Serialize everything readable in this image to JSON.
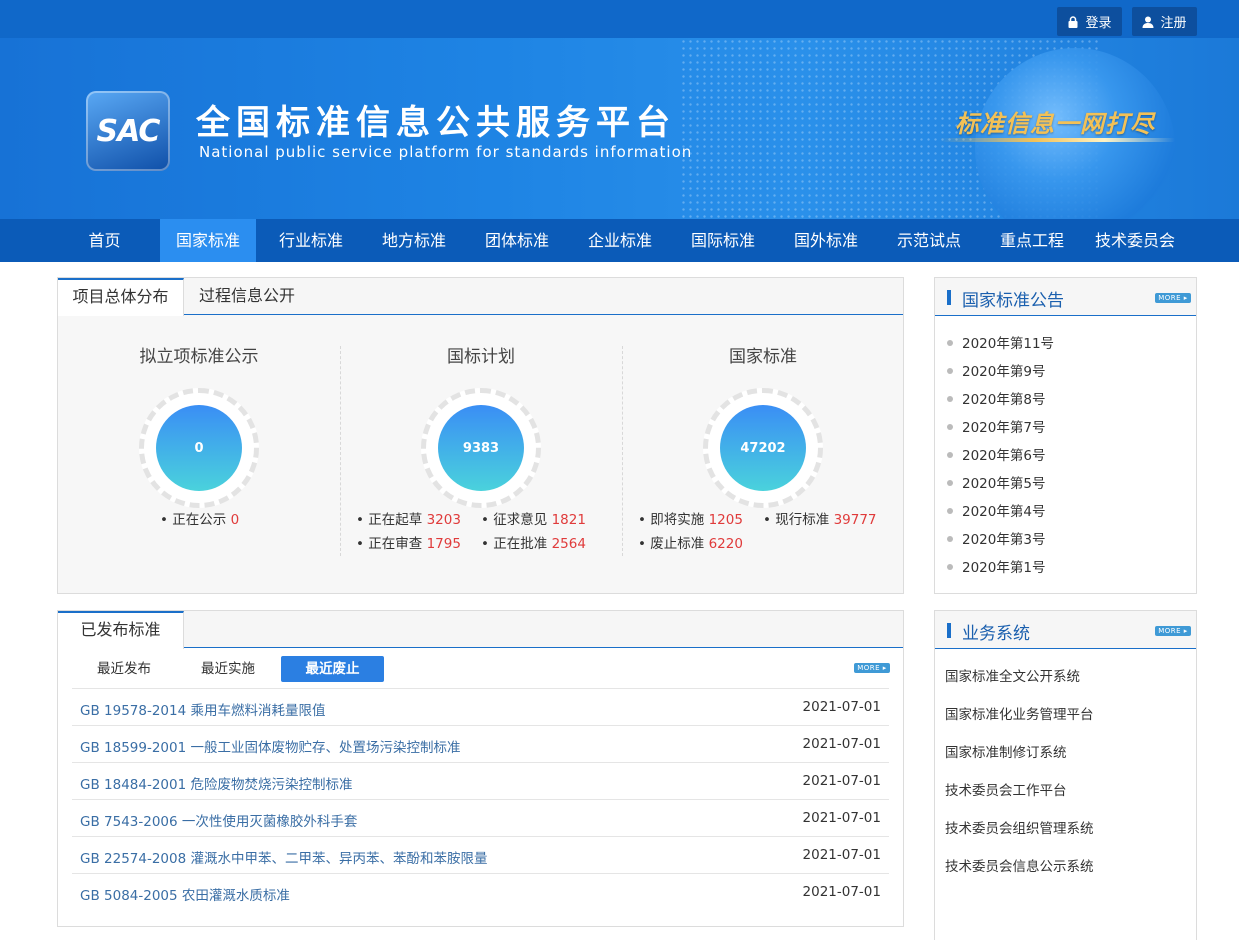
{
  "topbar": {
    "login": "登录",
    "register": "注册"
  },
  "banner": {
    "logo_text": "SAC",
    "title_cn": "全国标准信息公共服务平台",
    "title_en": "National public service platform  for standards information",
    "slogan": "标准信息一网打尽"
  },
  "nav": {
    "items": [
      "首页",
      "国家标准",
      "行业标准",
      "地方标准",
      "团体标准",
      "企业标准",
      "国际标准",
      "国外标准",
      "示范试点",
      "重点工程",
      "技术委员会"
    ],
    "active_index": 1
  },
  "overview": {
    "tabs": [
      "项目总体分布",
      "过程信息公开"
    ],
    "columns": [
      {
        "title": "拟立项标准公示",
        "total": "0",
        "lines": [
          [
            {
              "label": "正在公示",
              "value": "0"
            }
          ]
        ]
      },
      {
        "title": "国标计划",
        "total": "9383",
        "lines": [
          [
            {
              "label": "正在起草",
              "value": "3203"
            },
            {
              "label": "征求意见",
              "value": "1821"
            }
          ],
          [
            {
              "label": "正在审查",
              "value": "1795"
            },
            {
              "label": "正在批准",
              "value": "2564"
            }
          ]
        ]
      },
      {
        "title": "国家标准",
        "total": "47202",
        "lines": [
          [
            {
              "label": "即将实施",
              "value": "1205"
            },
            {
              "label": "现行标准",
              "value": "39777"
            }
          ],
          [
            {
              "label": "废止标准",
              "value": "6220"
            }
          ]
        ]
      }
    ]
  },
  "published": {
    "tab": "已发布标准",
    "subtabs": [
      "最近发布",
      "最近实施",
      "最近废止"
    ],
    "active_subtab": 2,
    "more": "MORE ▸",
    "rows": [
      {
        "name": "GB 19578-2014 乘用车燃料消耗量限值",
        "date": "2021-07-01"
      },
      {
        "name": "GB 18599-2001 一般工业固体废物贮存、处置场污染控制标准",
        "date": "2021-07-01"
      },
      {
        "name": "GB 18484-2001 危险废物焚烧污染控制标准",
        "date": "2021-07-01"
      },
      {
        "name": "GB 7543-2006 一次性使用灭菌橡胶外科手套",
        "date": "2021-07-01"
      },
      {
        "name": "GB 22574-2008 灌溉水中甲苯、二甲苯、异丙苯、苯酚和苯胺限量",
        "date": "2021-07-01"
      },
      {
        "name": "GB 5084-2005 农田灌溉水质标准",
        "date": "2021-07-01"
      }
    ]
  },
  "announcements": {
    "title": "国家标准公告",
    "more": "MORE ▸",
    "items": [
      "2020年第11号",
      "2020年第9号",
      "2020年第8号",
      "2020年第7号",
      "2020年第6号",
      "2020年第5号",
      "2020年第4号",
      "2020年第3号",
      "2020年第1号"
    ]
  },
  "systems": {
    "title": "业务系统",
    "more": "MORE ▸",
    "items": [
      "国家标准全文公开系统",
      "国家标准化业务管理平台",
      "国家标准制修订系统",
      "技术委员会工作平台",
      "技术委员会组织管理系统",
      "技术委员会信息公示系统"
    ]
  }
}
